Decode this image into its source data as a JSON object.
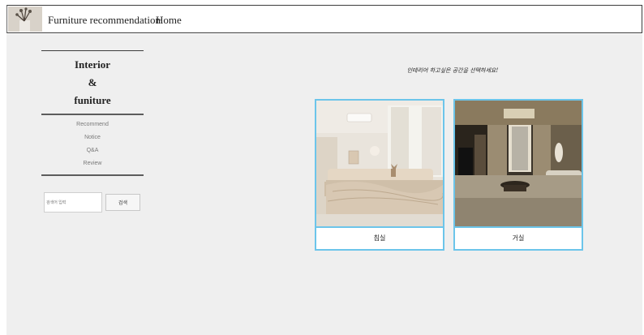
{
  "navbar": {
    "brand": "Furniture recommendation",
    "home": "Home"
  },
  "sidebar": {
    "title_lines": [
      "Interior",
      "&",
      "funiture"
    ],
    "menu": [
      "Recommend",
      "Notice",
      "Q&A",
      "Review"
    ],
    "search": {
      "placeholder": "검색어 입력",
      "button": "검색"
    }
  },
  "main": {
    "headline": "인테리어 하고싶은 공간을 선택하세요!",
    "cards": [
      {
        "label": "침실",
        "photo": "bedroom-photo"
      },
      {
        "label": "거실",
        "photo": "living-room-photo"
      }
    ]
  },
  "colors": {
    "accent": "#6cc5ea",
    "content_bg": "#efefef",
    "text": "#222222",
    "menu_text": "#7a7a7a"
  }
}
